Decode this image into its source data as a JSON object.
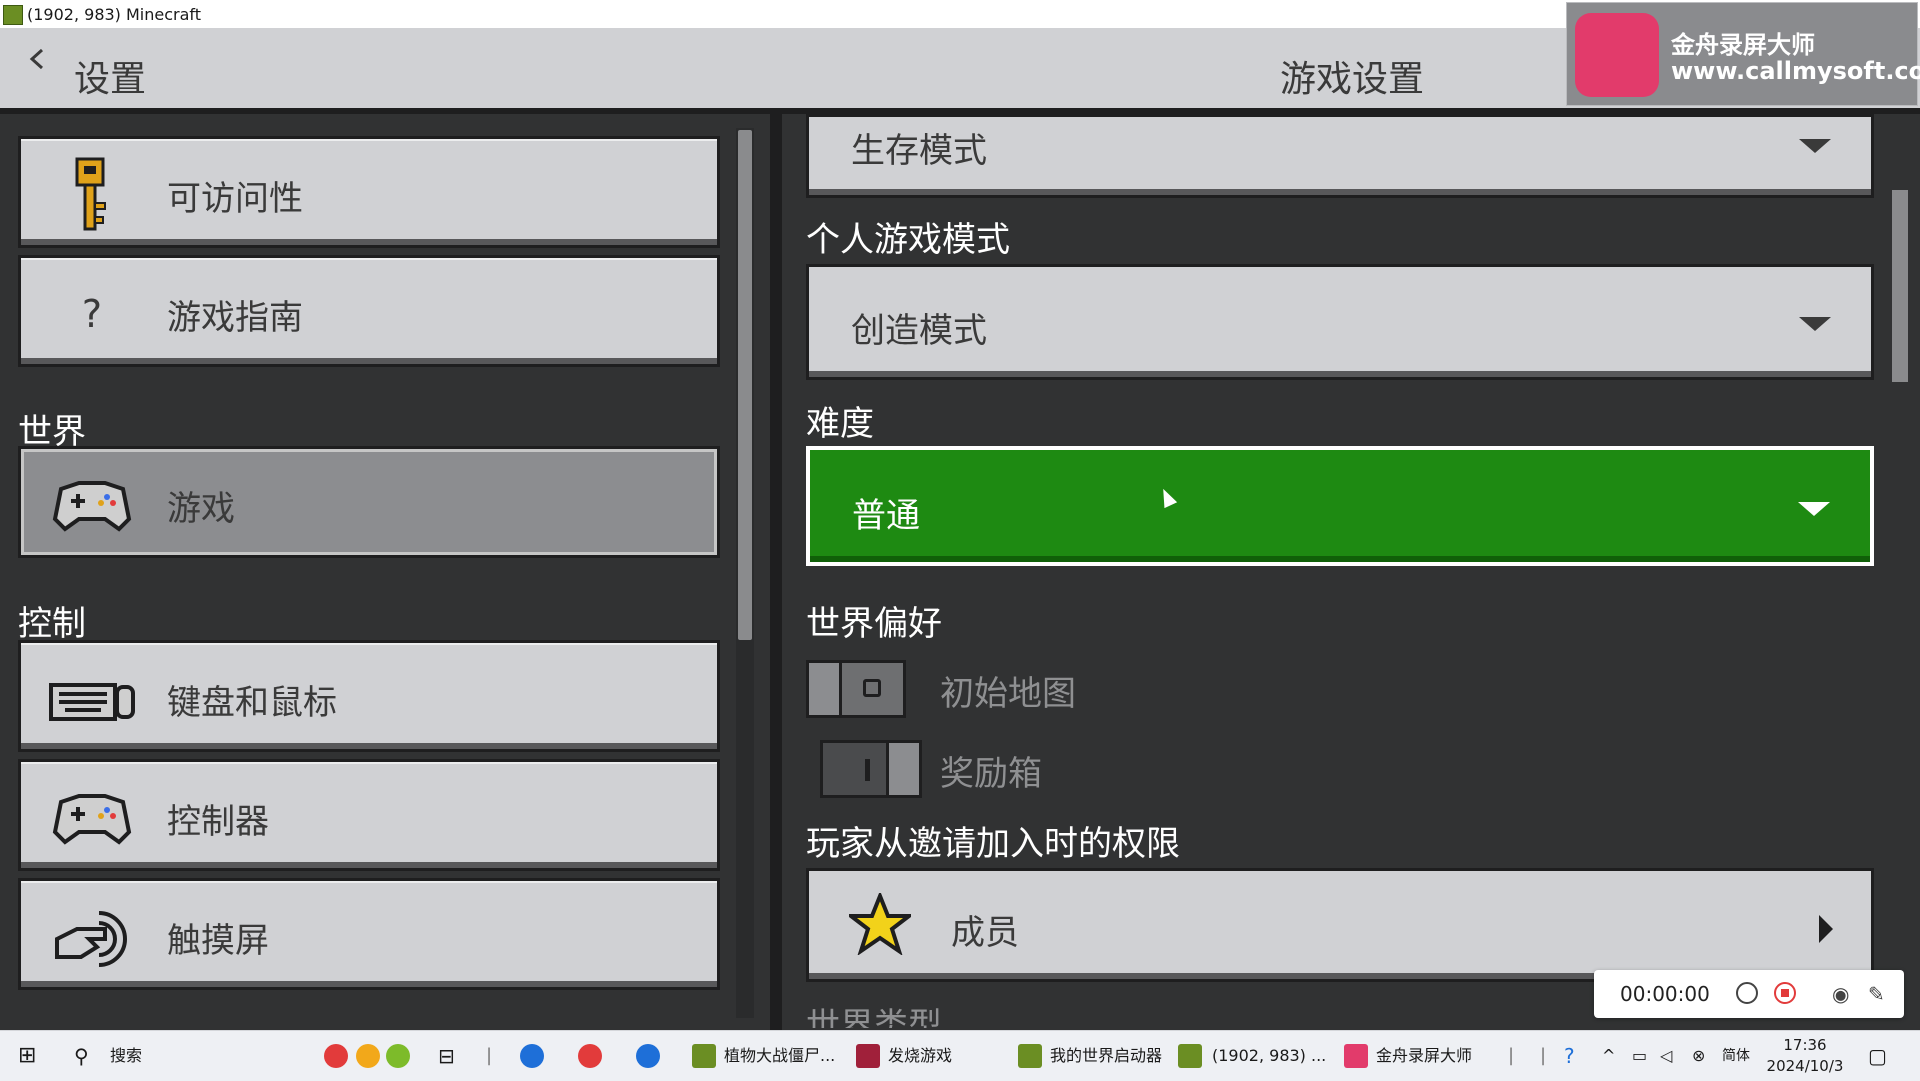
{
  "window": {
    "title": "(1902, 983) Minecraft",
    "min": "–",
    "max": "❐",
    "close": "✕"
  },
  "header": {
    "back_label": "设置",
    "page_title": "游戏设置"
  },
  "left_nav": {
    "items_top": [
      {
        "label": "可访问性",
        "icon": "key-icon"
      },
      {
        "label": "游戏指南",
        "icon": "question-icon",
        "glyph": "?"
      }
    ],
    "section_world": "世界",
    "item_world": {
      "label": "游戏",
      "icon": "gamepad-icon",
      "active": true
    },
    "section_controls": "控制",
    "items_controls": [
      {
        "label": "键盘和鼠标",
        "icon": "keyboard-icon"
      },
      {
        "label": "控制器",
        "icon": "gamepad-icon"
      },
      {
        "label": "触摸屏",
        "icon": "touch-icon"
      }
    ]
  },
  "settings": {
    "game_mode_value": "生存模式",
    "personal_mode_label": "个人游戏模式",
    "personal_mode_value": "创造模式",
    "difficulty_label": "难度",
    "difficulty_value": "普通",
    "world_prefs_label": "世界偏好",
    "starting_map_label": "初始地图",
    "starting_map_on": false,
    "bonus_chest_label": "奖励箱",
    "bonus_chest_on": true,
    "invite_perm_label": "玩家从邀请加入时的权限",
    "invite_perm_value": "成员",
    "world_type_label": "世界类型"
  },
  "recorder": {
    "name": "金舟录屏大师",
    "url": "www.callmysoft.com",
    "time": "00:00:00"
  },
  "taskbar": {
    "search": "搜索",
    "apps": [
      {
        "label": "植物大战僵尸..."
      },
      {
        "label": "发烧游戏"
      },
      {
        "label": "我的世界启动器"
      },
      {
        "label": "(1902, 983) ..."
      },
      {
        "label": "金舟录屏大师"
      }
    ],
    "ime": "简体",
    "time": "17:36",
    "date": "2024/10/3"
  },
  "colors": {
    "accent_green": "#1e8a12",
    "panel_bg": "#313233",
    "button_gray": "#d0d1d4"
  }
}
